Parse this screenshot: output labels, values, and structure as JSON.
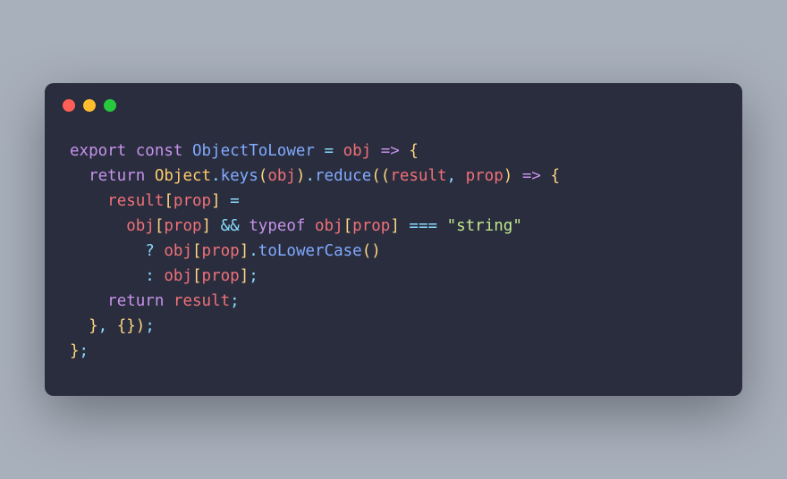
{
  "window": {
    "dots": [
      "red",
      "yellow",
      "green"
    ]
  },
  "code": {
    "tokens": [
      [
        {
          "t": "export ",
          "c": "kw-export"
        },
        {
          "t": "const ",
          "c": "kw-const"
        },
        {
          "t": "ObjectToLower",
          "c": "fn-name"
        },
        {
          "t": " = ",
          "c": "op"
        },
        {
          "t": "obj",
          "c": "param"
        },
        {
          "t": " ",
          "c": ""
        },
        {
          "t": "=>",
          "c": "arrow"
        },
        {
          "t": " ",
          "c": ""
        },
        {
          "t": "{",
          "c": "brace"
        }
      ],
      [
        {
          "t": "  ",
          "c": ""
        },
        {
          "t": "return ",
          "c": "kw-return"
        },
        {
          "t": "Object",
          "c": "obj"
        },
        {
          "t": ".",
          "c": "punct"
        },
        {
          "t": "keys",
          "c": "fn-call"
        },
        {
          "t": "(",
          "c": "paren"
        },
        {
          "t": "obj",
          "c": "ident"
        },
        {
          "t": ")",
          "c": "paren"
        },
        {
          "t": ".",
          "c": "punct"
        },
        {
          "t": "reduce",
          "c": "fn-call"
        },
        {
          "t": "((",
          "c": "paren"
        },
        {
          "t": "result",
          "c": "param"
        },
        {
          "t": ", ",
          "c": "punct"
        },
        {
          "t": "prop",
          "c": "param"
        },
        {
          "t": ")",
          "c": "paren"
        },
        {
          "t": " ",
          "c": ""
        },
        {
          "t": "=>",
          "c": "arrow"
        },
        {
          "t": " ",
          "c": ""
        },
        {
          "t": "{",
          "c": "brace"
        }
      ],
      [
        {
          "t": "    ",
          "c": ""
        },
        {
          "t": "result",
          "c": "ident"
        },
        {
          "t": "[",
          "c": "bracket"
        },
        {
          "t": "prop",
          "c": "ident"
        },
        {
          "t": "]",
          "c": "bracket"
        },
        {
          "t": " =",
          "c": "op"
        }
      ],
      [
        {
          "t": "      ",
          "c": ""
        },
        {
          "t": "obj",
          "c": "ident"
        },
        {
          "t": "[",
          "c": "bracket"
        },
        {
          "t": "prop",
          "c": "ident"
        },
        {
          "t": "]",
          "c": "bracket"
        },
        {
          "t": " ",
          "c": ""
        },
        {
          "t": "&&",
          "c": "op"
        },
        {
          "t": " ",
          "c": ""
        },
        {
          "t": "typeof ",
          "c": "kw-typeof"
        },
        {
          "t": "obj",
          "c": "ident"
        },
        {
          "t": "[",
          "c": "bracket"
        },
        {
          "t": "prop",
          "c": "ident"
        },
        {
          "t": "]",
          "c": "bracket"
        },
        {
          "t": " ",
          "c": ""
        },
        {
          "t": "===",
          "c": "op"
        },
        {
          "t": " ",
          "c": ""
        },
        {
          "t": "\"string\"",
          "c": "str"
        }
      ],
      [
        {
          "t": "        ",
          "c": ""
        },
        {
          "t": "?",
          "c": "op"
        },
        {
          "t": " ",
          "c": ""
        },
        {
          "t": "obj",
          "c": "ident"
        },
        {
          "t": "[",
          "c": "bracket"
        },
        {
          "t": "prop",
          "c": "ident"
        },
        {
          "t": "]",
          "c": "bracket"
        },
        {
          "t": ".",
          "c": "punct"
        },
        {
          "t": "toLowerCase",
          "c": "fn-call"
        },
        {
          "t": "()",
          "c": "paren"
        }
      ],
      [
        {
          "t": "        ",
          "c": ""
        },
        {
          "t": ":",
          "c": "op"
        },
        {
          "t": " ",
          "c": ""
        },
        {
          "t": "obj",
          "c": "ident"
        },
        {
          "t": "[",
          "c": "bracket"
        },
        {
          "t": "prop",
          "c": "ident"
        },
        {
          "t": "]",
          "c": "bracket"
        },
        {
          "t": ";",
          "c": "punct"
        }
      ],
      [
        {
          "t": "    ",
          "c": ""
        },
        {
          "t": "return ",
          "c": "kw-return"
        },
        {
          "t": "result",
          "c": "ident"
        },
        {
          "t": ";",
          "c": "punct"
        }
      ],
      [
        {
          "t": "  ",
          "c": ""
        },
        {
          "t": "}",
          "c": "brace"
        },
        {
          "t": ", ",
          "c": "punct"
        },
        {
          "t": "{}",
          "c": "brace"
        },
        {
          "t": ")",
          "c": "paren"
        },
        {
          "t": ";",
          "c": "punct"
        }
      ],
      [
        {
          "t": "}",
          "c": "brace"
        },
        {
          "t": ";",
          "c": "punct"
        }
      ]
    ]
  }
}
